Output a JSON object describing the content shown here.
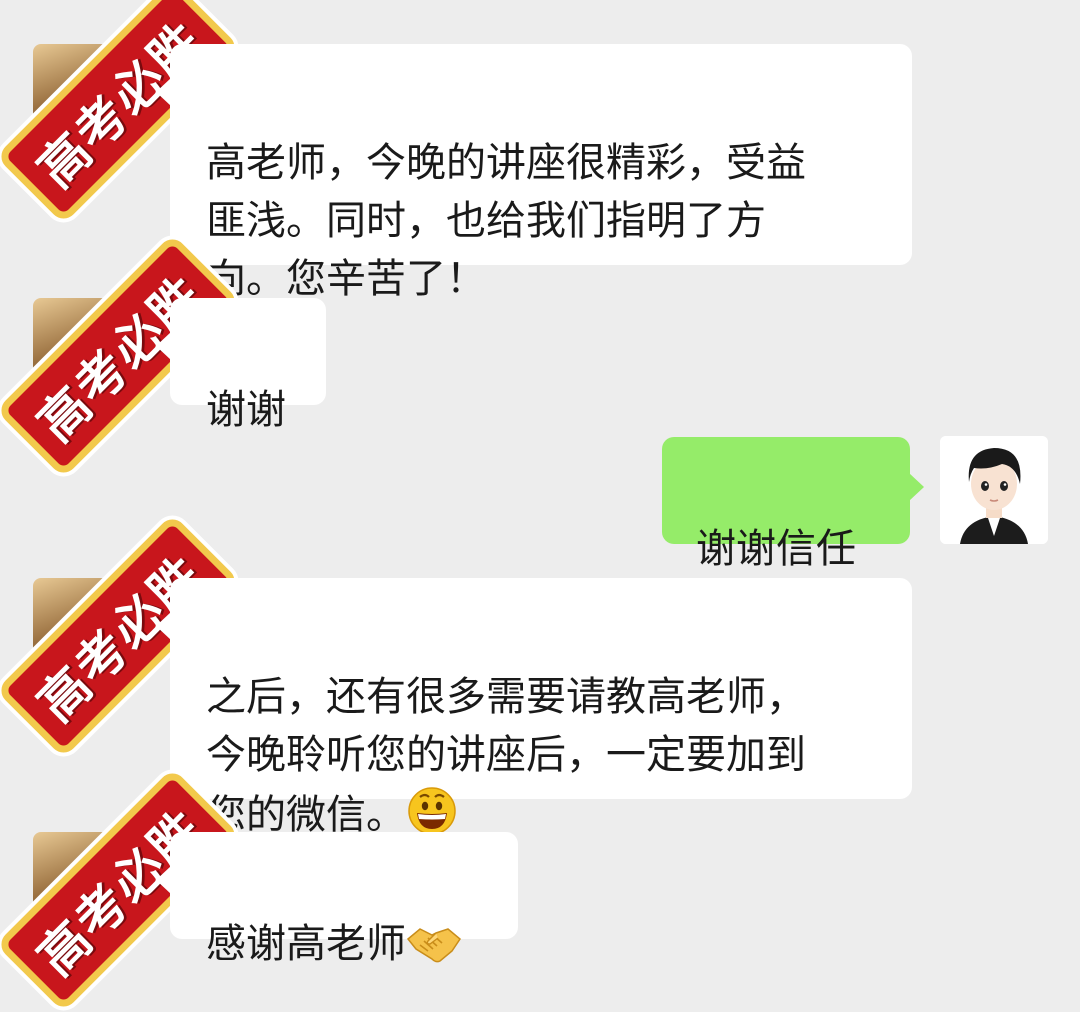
{
  "messages": [
    {
      "side": "left",
      "text": "高老师，今晚的讲座很精彩，受益\n匪浅。同时，也给我们指明了方\n向。您辛苦了！"
    },
    {
      "side": "left",
      "text": "谢谢"
    },
    {
      "side": "right",
      "text": "谢谢信任"
    },
    {
      "side": "left",
      "text": "之后，还有很多需要请教高老师，\n今晚聆听您的讲座后，一定要加到\n您的微信。"
    },
    {
      "side": "left",
      "text": "感谢高老师"
    }
  ],
  "stamp": {
    "text": "高考必胜"
  },
  "icons": {
    "grin": "grinning-face-emoji",
    "handshake": "handshake-emoji",
    "self_avatar": "cartoon-boy-avatar"
  },
  "colors": {
    "background": "#ededed",
    "incoming_bubble": "#ffffff",
    "outgoing_bubble": "#95ec69",
    "stamp_red": "#c8161c",
    "stamp_gold": "#f2c94c"
  }
}
